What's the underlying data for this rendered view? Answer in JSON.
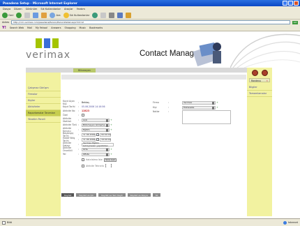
{
  "window": {
    "title": "Pasadena Setup - Microsoft Internet Explorer"
  },
  "menu": [
    "Dosya",
    "Düzen",
    "Görünüm",
    "Sık Kullanılanlar",
    "Araçlar",
    "Yardım"
  ],
  "toolbar": {
    "back_label": "Geri",
    "search_label": "Ara",
    "favorites_label": "Sık Kullanılanlar"
  },
  "address": {
    "label": "Adres",
    "url": "http://crm.verimax.com/pasadena/Person/PersonDetail.aspx?id=12",
    "go_label": "Git"
  },
  "links": {
    "yahoo_label": "Y!",
    "items": [
      "Search Web",
      "Mail",
      "My Yahoo!",
      "Answers",
      "Shopping",
      "Music",
      "Bookmarks"
    ]
  },
  "app": {
    "logo_text": "verimax",
    "title": "Contact Manager"
  },
  "tabs": {
    "active_label": "Bilinmeyen"
  },
  "sidebar": {
    "items": [
      "Çalışmaz Görüşm",
      "Firmalar",
      "Kişiler",
      "Aktiviteler",
      "Raporlamalar Tanımları",
      "Yönetim Paneli"
    ]
  },
  "right_panel": {
    "select_label": "Randevu",
    "items": [
      "Bilgiler",
      "Tamamlamalar"
    ]
  },
  "form": {
    "left_fields": [
      {
        "label": "Kayıt Açan Kişi",
        "value": "Bektaş"
      },
      {
        "label": "Kayıt Tarihi",
        "value": "05.06.2006 14:16:56"
      },
      {
        "label": "Aktivite No",
        "value": "12823"
      },
      {
        "label": "Özel",
        "value": ""
      },
      {
        "label": "Aktivite Statüsü",
        "value": "Açık"
      },
      {
        "label": "Aktivite Türü",
        "value": "Bilinmeyen Görüşme"
      },
      {
        "label": "Aktivite Konusu",
        "value": "Eğitim"
      },
      {
        "label": "Başlangıç Tarihi",
        "date": "11.06.2006",
        "time": "09:00:00"
      },
      {
        "label": "Hedef Bitiş Tarihi",
        "date": "11.06.2006",
        "time": "18:00:00"
      },
      {
        "label": "Aktivite Detayı",
        "value": "Verimax Eğitim Görüşmeleri yapıldıktan"
      },
      {
        "label": "Aktivite Öncelikli",
        "value": "Orta"
      },
      {
        "label": "Yer",
        "value": "Ofiste"
      }
    ],
    "right_fields": [
      {
        "label": "Firma",
        "value": "Verimax"
      },
      {
        "label": "Kişi",
        "value": "Muhasebe"
      },
      {
        "label": "Notlar",
        "value": ""
      }
    ],
    "reminder_label": "Hatırlatma İste",
    "reminder_btn": "Süre Çek",
    "recur_label": "Aktivite Tekrarla",
    "bottom_buttons": [
      "Kaydet",
      "Kaydet ve Çık",
      "Kaydet ve Yeni Kayıt",
      "Kaydet ve Kopya",
      "Sil"
    ]
  },
  "status": {
    "left_text": "Bitti",
    "zone_text": "Internet"
  },
  "colors": {
    "title_blue": "#0a48c6",
    "sidebar_yellow": "#f2f2a0",
    "selected_olive": "#c6cd4f",
    "link_purple": "#4b4b9a",
    "logo_green": "#a4c400",
    "logo_blue": "#3b6fd8"
  }
}
